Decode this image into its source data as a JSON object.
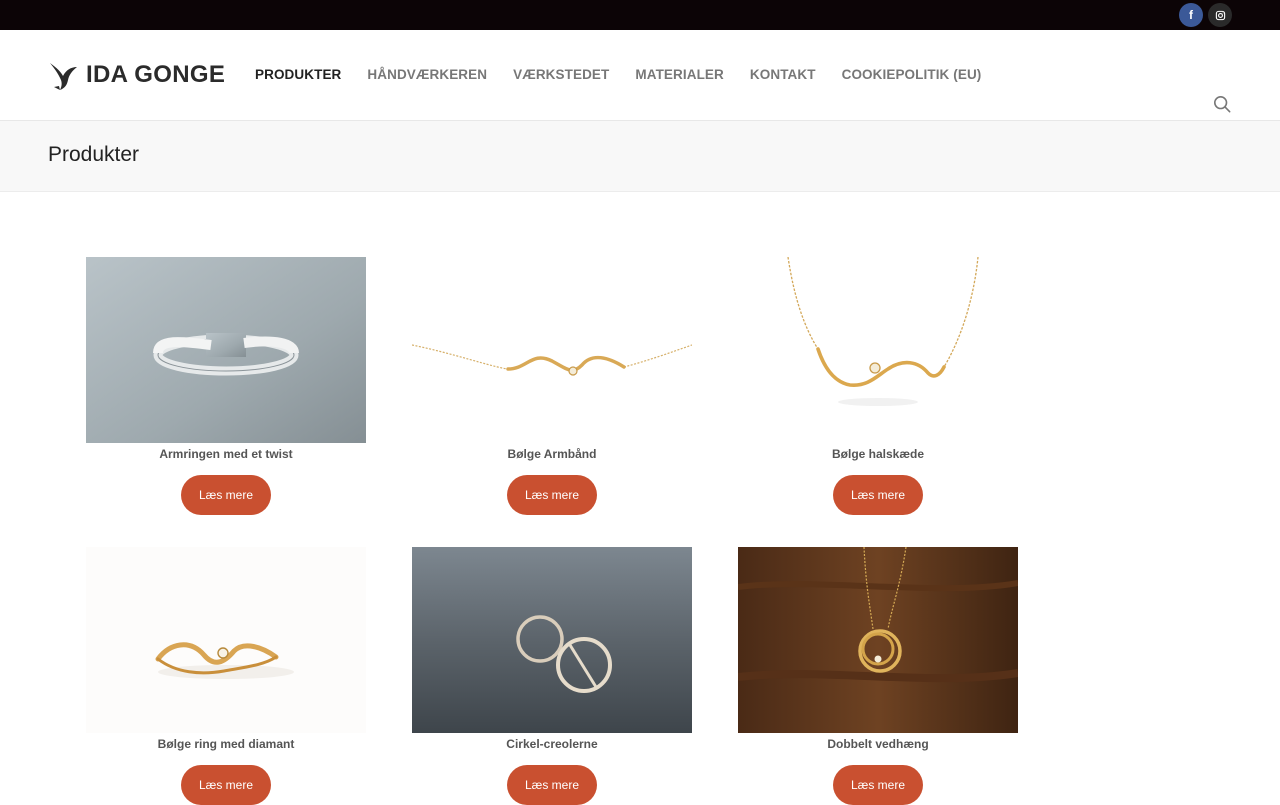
{
  "site": {
    "name": "IDA GONGE"
  },
  "social": {
    "facebook_glyph": "f",
    "instagram_icon": "instagram-icon"
  },
  "nav": {
    "items": [
      {
        "label": "PRODUKTER",
        "active": true
      },
      {
        "label": "HÅNDVÆRKEREN",
        "active": false
      },
      {
        "label": "VÆRKSTEDET",
        "active": false
      },
      {
        "label": "MATERIALER",
        "active": false
      },
      {
        "label": "KONTAKT",
        "active": false
      },
      {
        "label": "COOKIEPOLITIK (EU)",
        "active": false
      }
    ]
  },
  "page": {
    "title": "Produkter"
  },
  "products": [
    {
      "title": "Armringen med et twist",
      "button": "Læs mere"
    },
    {
      "title": "Bølge Armbånd",
      "button": "Læs mere"
    },
    {
      "title": "Bølge halskæde",
      "button": "Læs mere"
    },
    {
      "title": "Bølge ring med diamant",
      "button": "Læs mere"
    },
    {
      "title": "Cirkel-creolerne",
      "button": "Læs mere"
    },
    {
      "title": "Dobbelt vedhæng",
      "button": "Læs mere"
    }
  ],
  "colors": {
    "topbar": "#0c0406",
    "accent": "#c95030",
    "facebook": "#3b5998"
  }
}
